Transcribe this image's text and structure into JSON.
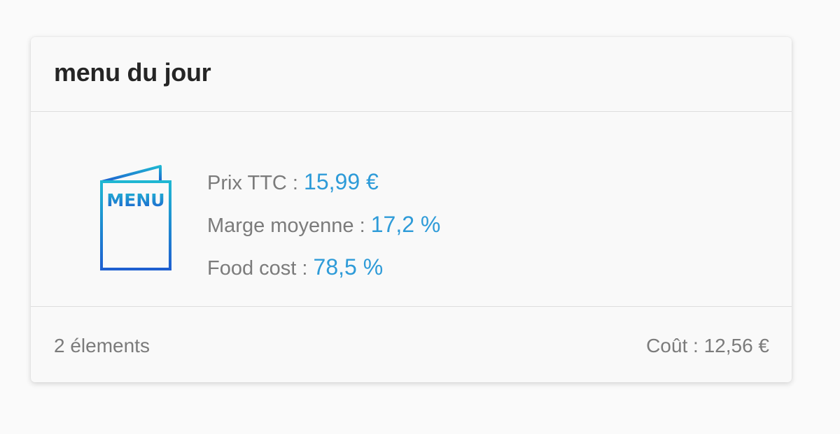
{
  "card": {
    "title": "menu du jour",
    "icon": "menu-card-icon",
    "icon_text": "MENU",
    "accent_color": "#2e9bd8",
    "stats": [
      {
        "label": "Prix TTC",
        "value": "15,99 €"
      },
      {
        "label": "Marge moyenne",
        "value": "17,2 %"
      },
      {
        "label": "Food cost",
        "value": "78,5 %"
      }
    ],
    "separator": " : ",
    "footer": {
      "items_count": "2 élements",
      "cost_label": "Coût",
      "cost_value": "12,56 €"
    }
  }
}
